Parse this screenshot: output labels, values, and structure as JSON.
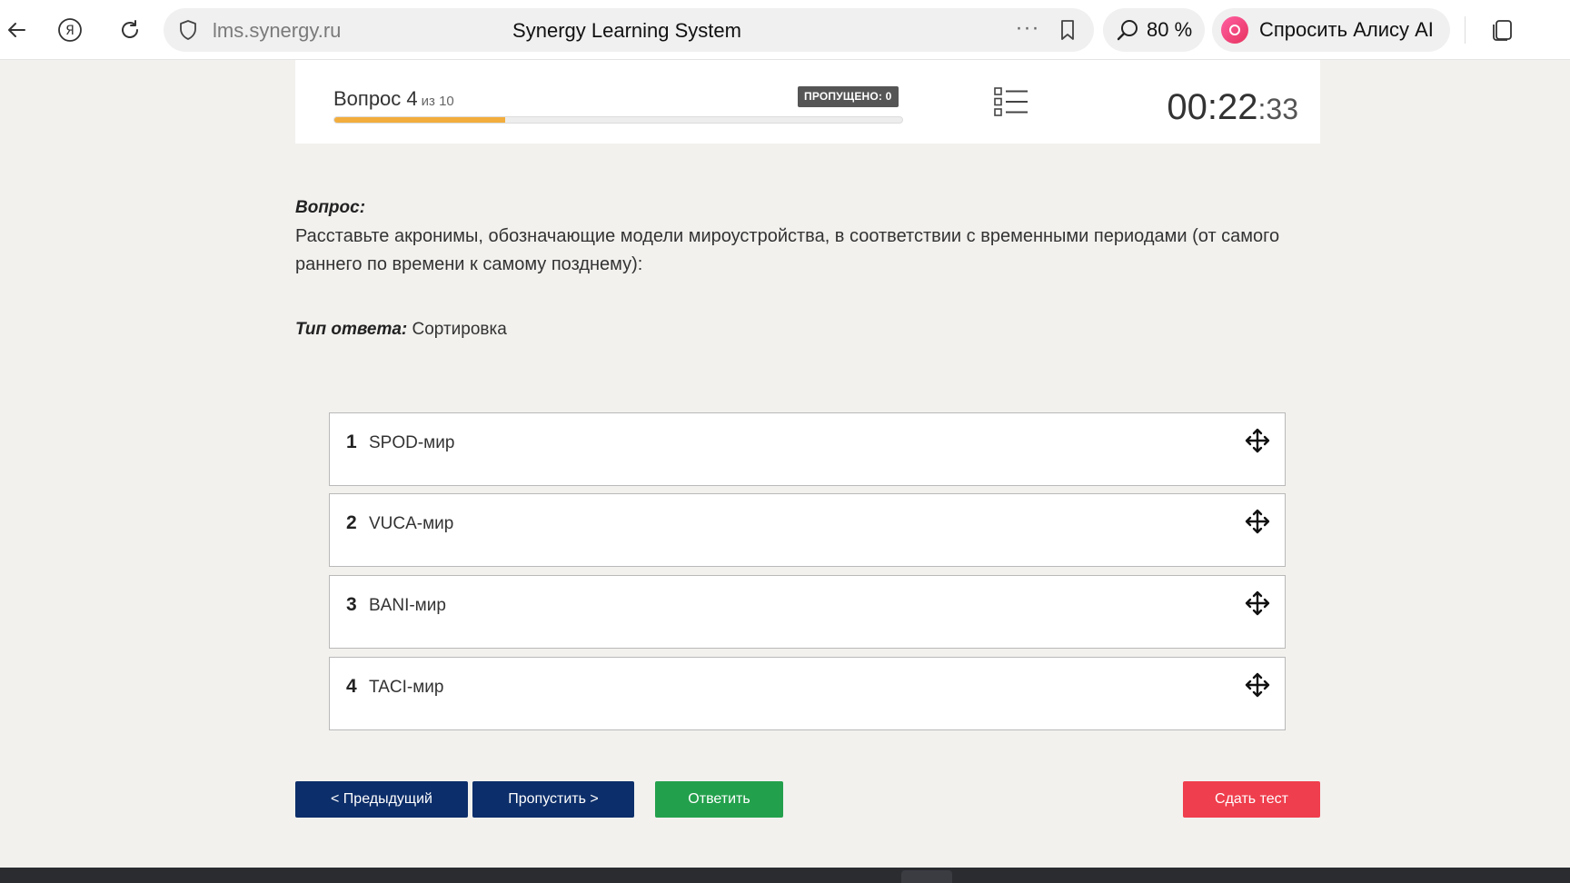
{
  "browser": {
    "url": "lms.synergy.ru",
    "page_title": "Synergy Learning System",
    "zoom": "80 %",
    "alice_label": "Спросить Алису AI",
    "icons": [
      "back-arrow-icon",
      "yandex-icon",
      "reload-icon",
      "shield-icon",
      "more-dots-icon",
      "bookmark-icon",
      "search-icon",
      "alice-icon",
      "tabs-icon"
    ]
  },
  "test": {
    "question_label": "Вопрос 4",
    "question_of": "из 10",
    "current": 4,
    "total": 10,
    "progress_fraction": 0.3,
    "skipped": "ПРОПУЩЕНО: 0",
    "timer_main": "00:22",
    "timer_sec": ":33"
  },
  "question": {
    "label": "Вопрос:",
    "text": "Расставьте акронимы, обозначающие модели мироустройства, в соответствии с временными периодами (от самого раннего по времени к самому позднему):",
    "answer_type_label": "Тип ответа:",
    "answer_type_value": "Сортировка"
  },
  "items": [
    {
      "num": "1",
      "text": "SPOD-мир"
    },
    {
      "num": "2",
      "text": "VUCA-мир"
    },
    {
      "num": "3",
      "text": "BANI-мир"
    },
    {
      "num": "4",
      "text": "TACI-мир"
    }
  ],
  "buttons": {
    "prev": "< Предыдущий",
    "skip": "Пропустить >",
    "answer": "Ответить",
    "submit": "Сдать тест"
  },
  "colors": {
    "progress": "#f2ad3d",
    "nav_button": "#0c2e6a",
    "answer_button": "#23a04c",
    "submit_button": "#ef3e4d"
  }
}
